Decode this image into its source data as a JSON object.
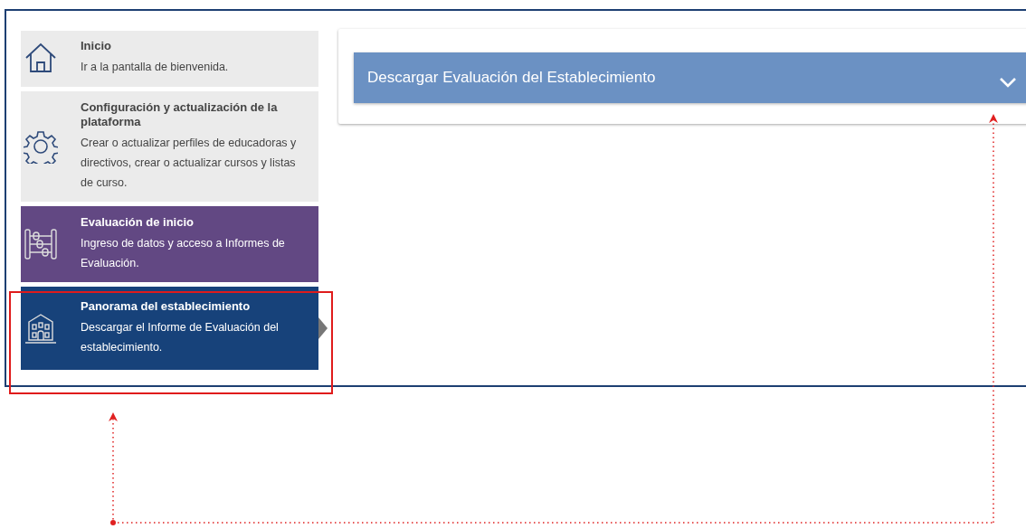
{
  "sidebar": {
    "items": [
      {
        "kind": "home",
        "title": "Inicio",
        "description": "Ir a la pantalla de bienvenida.",
        "color": "#ebebeb",
        "selected": false
      },
      {
        "kind": "gear",
        "title": "Configuración y actualización de la plataforma",
        "description": "Crear o actualizar perfiles de educadoras y directivos, crear o actualizar cursos y listas de curso.",
        "color": "#ebebeb",
        "selected": false
      },
      {
        "kind": "abacus",
        "title": "Evaluación de inicio",
        "description": "Ingreso de datos y acceso a Informes de Evaluación.",
        "color": "#624883",
        "selected": false
      },
      {
        "kind": "building",
        "title": "Panorama del establecimiento",
        "description": "Descargar el Informe de Evaluación del establecimiento.",
        "color": "#17427a",
        "selected": true
      }
    ]
  },
  "panel": {
    "accordion": {
      "title": "Descargar Evaluación del Establecimiento",
      "expanded": false
    }
  }
}
